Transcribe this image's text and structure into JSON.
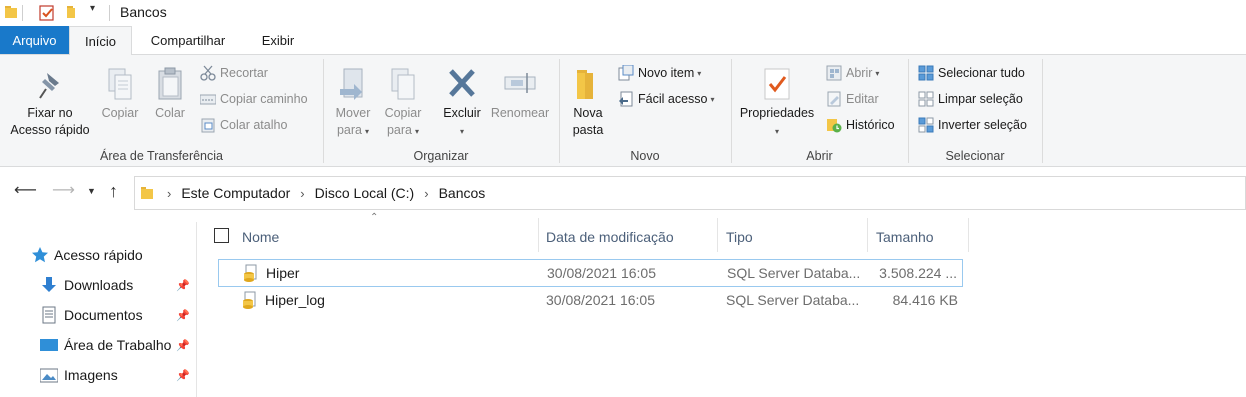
{
  "window": {
    "title": "Bancos"
  },
  "tabs": {
    "file": "Arquivo",
    "home": "Início",
    "share": "Compartilhar",
    "view": "Exibir"
  },
  "ribbon": {
    "clipboard": {
      "label": "Área de Transferência",
      "pin_line1": "Fixar no",
      "pin_line2": "Acesso rápido",
      "copy": "Copiar",
      "paste": "Colar",
      "cut": "Recortar",
      "copy_path": "Copiar caminho",
      "paste_shortcut": "Colar atalho"
    },
    "organize": {
      "label": "Organizar",
      "move_line1": "Mover",
      "move_line2": "para",
      "copyto_line1": "Copiar",
      "copyto_line2": "para",
      "delete": "Excluir",
      "rename": "Renomear"
    },
    "new": {
      "label": "Novo",
      "new_folder_line1": "Nova",
      "new_folder_line2": "pasta",
      "new_item": "Novo item",
      "easy_access": "Fácil acesso"
    },
    "open": {
      "label": "Abrir",
      "properties": "Propriedades",
      "open": "Abrir",
      "edit": "Editar",
      "history": "Histórico"
    },
    "select": {
      "label": "Selecionar",
      "select_all": "Selecionar tudo",
      "select_none": "Limpar seleção",
      "invert": "Inverter seleção"
    }
  },
  "address": {
    "crumbs": [
      "Este Computador",
      "Disco Local (C:)",
      "Bancos"
    ]
  },
  "nav": {
    "quick_access": "Acesso rápido",
    "items": [
      {
        "label": "Downloads",
        "icon": "download-icon"
      },
      {
        "label": "Documentos",
        "icon": "documents-icon"
      },
      {
        "label": "Área de Trabalho",
        "icon": "desktop-icon"
      },
      {
        "label": "Imagens",
        "icon": "pictures-icon"
      }
    ]
  },
  "columns": {
    "name": "Nome",
    "date": "Data de modificação",
    "type": "Tipo",
    "size": "Tamanho"
  },
  "files": [
    {
      "name": "Hiper",
      "date": "30/08/2021 16:05",
      "type": "SQL Server Databa...",
      "size": "3.508.224 ..."
    },
    {
      "name": "Hiper_log",
      "date": "30/08/2021 16:05",
      "type": "SQL Server Databa...",
      "size": "84.416 KB"
    }
  ],
  "colors": {
    "file_tab": "#1979ca",
    "ribbon_bg": "#f5f6f7",
    "selection_border": "#99c9ef",
    "folder": "#f3c647"
  }
}
